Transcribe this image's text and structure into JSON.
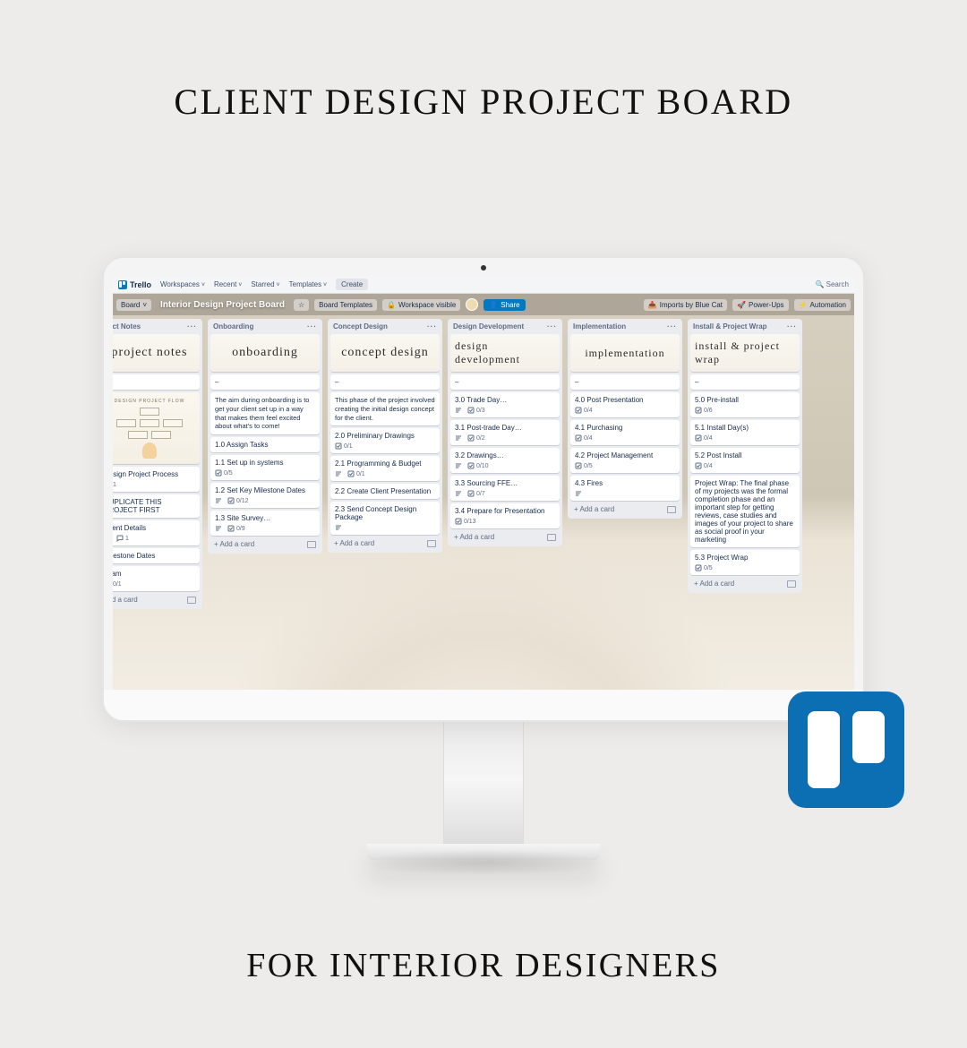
{
  "hero": {
    "title": "CLIENT DESIGN PROJECT BOARD",
    "subtitle": "FOR INTERIOR DESIGNERS"
  },
  "topnav": {
    "brand": "Trello",
    "items": [
      "Workspaces",
      "Recent",
      "Starred",
      "Templates"
    ],
    "create": "Create",
    "search": "Search"
  },
  "boardbar": {
    "board_btn": "Board",
    "title": "Interior Design Project Board",
    "templates_btn": "Board Templates",
    "workspace_btn": "Workspace visible",
    "share": "Share",
    "imports": "Imports by Blue Cat",
    "powerups": "Power-Ups",
    "automation": "Automation"
  },
  "lists": [
    {
      "name": "oject Notes",
      "header_image_text": "project notes",
      "flow_caption": "DESIGN PROJECT FLOW",
      "cards": [
        {
          "title": "Design Project Process",
          "attach": "1"
        },
        {
          "title": "DUPLICATE THIS PROJECT FIRST"
        },
        {
          "title": "Client Details",
          "desc": true,
          "comment": "1"
        },
        {
          "title": "Milestone Dates"
        },
        {
          "title": "Team",
          "check": "0/1"
        }
      ],
      "add": "Add a card"
    },
    {
      "name": "Onboarding",
      "header_image_text": "onboarding",
      "intro": "The aim during onboarding is to get your client set up in a way that makes them feel excited about what's to come!",
      "cards": [
        {
          "title": "1.0 Assign Tasks"
        },
        {
          "title": "1.1 Set up in systems",
          "check": "0/5"
        },
        {
          "title": "1.2 Set Key Milestone Dates",
          "desc": true,
          "check": "0/12"
        },
        {
          "title": "1.3 Site Survey…",
          "desc": true,
          "check": "0/9"
        }
      ],
      "add": "+ Add a card"
    },
    {
      "name": "Concept Design",
      "header_image_text": "concept design",
      "intro": "This phase of the project involved creating the initial design concept for the client.",
      "cards": [
        {
          "title": "2.0 Preliminary Drawings",
          "check": "0/1"
        },
        {
          "title": "2.1 Programming & Budget",
          "desc": true,
          "check": "0/1"
        },
        {
          "title": "2.2 Create Client Presentation"
        },
        {
          "title": "2.3 Send Concept Design Package",
          "desc": true
        }
      ],
      "add": "+ Add a card"
    },
    {
      "name": "Design Development",
      "header_image_text": "design development",
      "cards": [
        {
          "title": "3.0 Trade Day…",
          "desc": true,
          "check": "0/3"
        },
        {
          "title": "3.1 Post-trade Day…",
          "desc": true,
          "check": "0/2"
        },
        {
          "title": "3.2 Drawings…",
          "desc": true,
          "check": "0/10"
        },
        {
          "title": "3.3 Sourcing FFE…",
          "desc": true,
          "check": "0/7"
        },
        {
          "title": "3.4 Prepare for Presentation",
          "check": "0/13"
        }
      ],
      "add": "+ Add a card"
    },
    {
      "name": "Implementation",
      "header_image_text": "implementation",
      "cards": [
        {
          "title": "4.0 Post Presentation",
          "check": "0/4"
        },
        {
          "title": "4.1 Purchasing",
          "check": "0/4"
        },
        {
          "title": "4.2 Project Management",
          "check": "0/5"
        },
        {
          "title": "4.3 Fires",
          "desc": true
        }
      ],
      "add": "+ Add a card"
    },
    {
      "name": "Install & Project Wrap",
      "header_image_text": "install & project wrap",
      "cards": [
        {
          "title": "5.0 Pre-install",
          "check": "0/6"
        },
        {
          "title": "5.1 Install Day(s)",
          "check": "0/4"
        },
        {
          "title": "5.2 Post Install",
          "check": "0/4"
        },
        {
          "title": "Project Wrap: The final phase of my projects was the formal completion phase and an important step for getting reviews, case studies and images of your project to share as social proof in your marketing"
        },
        {
          "title": "5.3 Project Wrap",
          "check": "0/5"
        }
      ],
      "add": "+ Add a card"
    }
  ],
  "icons": {
    "search": "🔍",
    "lightning": "⚡",
    "rocket": "🚀",
    "inbox": "📥"
  }
}
